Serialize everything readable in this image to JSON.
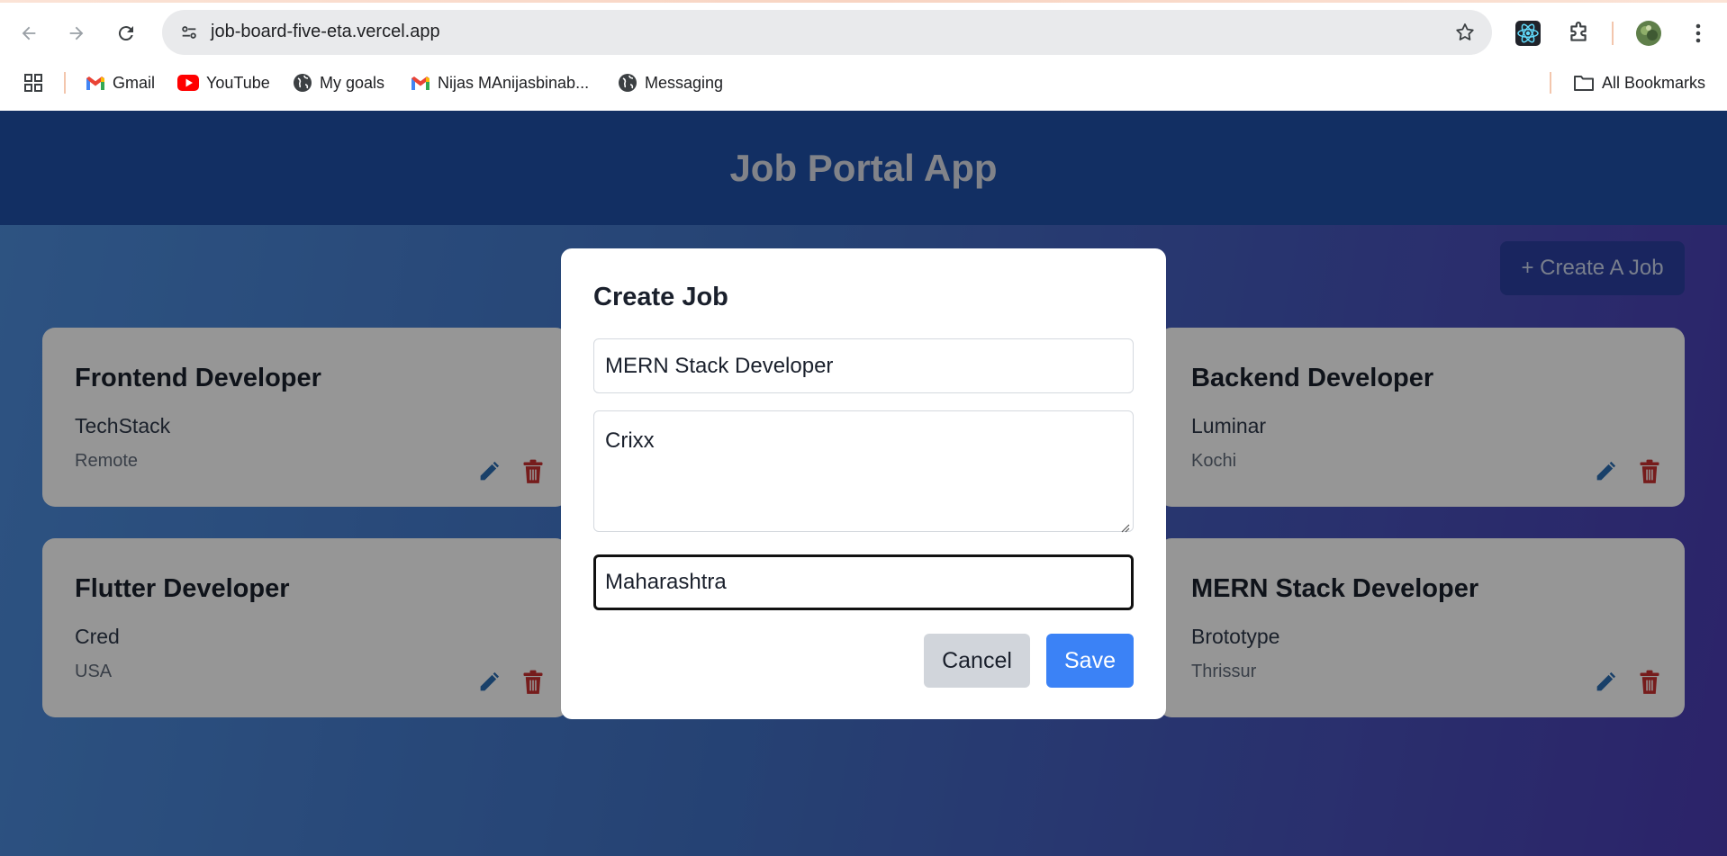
{
  "browser": {
    "url": "job-board-five-eta.vercel.app",
    "bookmarks": [
      {
        "label": "Gmail",
        "icon": "gmail-icon"
      },
      {
        "label": "YouTube",
        "icon": "youtube-icon"
      },
      {
        "label": "My goals",
        "icon": "globe-icon"
      },
      {
        "label": "Nijas MAnijasbinab...",
        "icon": "gmail-icon"
      },
      {
        "label": "Messaging",
        "icon": "globe-icon"
      }
    ],
    "all_bookmarks": "All Bookmarks"
  },
  "app": {
    "title": "Job Portal App",
    "create_button": "+ Create A Job",
    "jobs": [
      {
        "title": "Frontend Developer",
        "company": "TechStack",
        "location": "Remote"
      },
      {
        "title": "Backend Developer",
        "company": "Luminar",
        "location": "Kochi"
      },
      {
        "title": "Flutter Developer",
        "company": "Cred",
        "location": "USA"
      },
      {
        "title": "MERN Stack Developer",
        "company": "Brototype",
        "location": "Thrissur"
      }
    ]
  },
  "modal": {
    "title": "Create Job",
    "job_title_value": "MERN Stack Developer",
    "company_value": "Crixx",
    "location_value": "Maharashtra",
    "cancel_label": "Cancel",
    "save_label": "Save"
  },
  "colors": {
    "header": "#1e4fa6",
    "save": "#3b82f6",
    "edit_icon": "#2b6cb0",
    "delete_icon": "#c53030"
  }
}
